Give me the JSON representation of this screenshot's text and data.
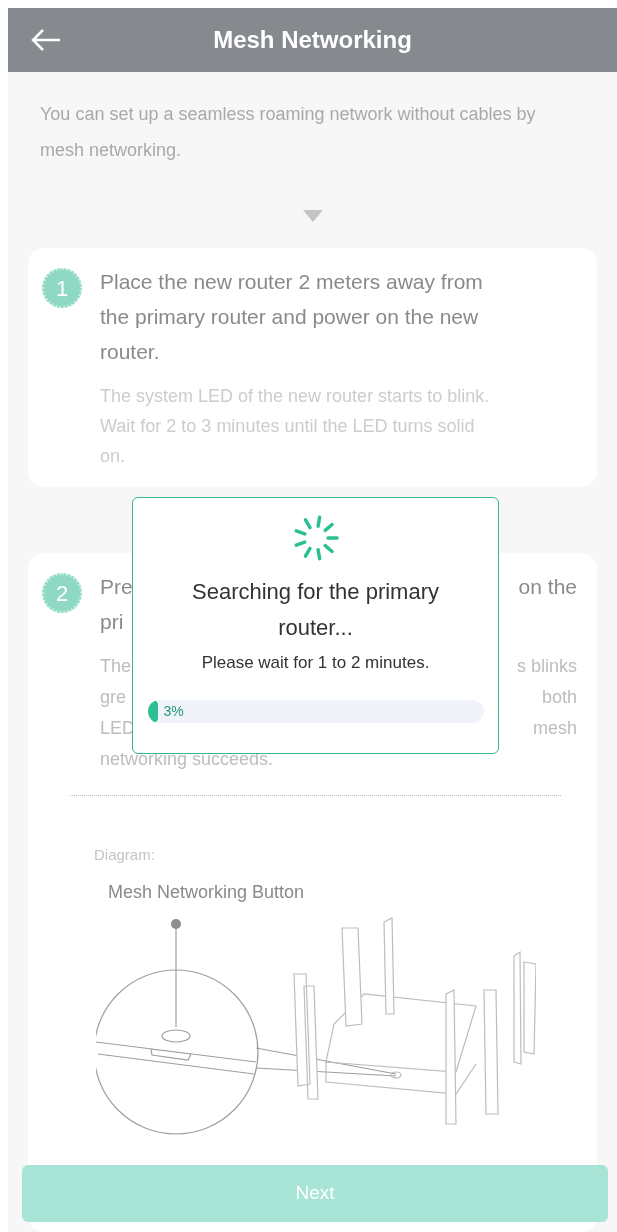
{
  "header": {
    "title": "Mesh Networking"
  },
  "intro": "You can set up a seamless roaming network without cables by mesh networking.",
  "steps": [
    {
      "number": "1",
      "title_lines": [
        {
          "left": "Place the new router 2 meters away from"
        },
        {
          "left": "the primary router and power on the new"
        },
        {
          "left": "router."
        }
      ],
      "desc_lines": [
        {
          "left": "The system LED of the new router starts to blink."
        },
        {
          "left": "Wait for 2 to 3 minutes until the LED turns solid"
        },
        {
          "left": "on."
        }
      ]
    },
    {
      "number": "2",
      "title_lines": [
        {
          "left": "Pre",
          "right": "on the"
        },
        {
          "left": "pri"
        }
      ],
      "desc_lines": [
        {
          "left": "The",
          "right": "s blinks"
        },
        {
          "left": "gre",
          "right": "both"
        },
        {
          "left": "LED",
          "right": "mesh"
        },
        {
          "left": "networking succeeds."
        }
      ],
      "diagram": {
        "label": "Diagram:",
        "callout": "Mesh Networking Button"
      }
    }
  ],
  "dialog": {
    "title": "Searching for the primary router...",
    "subtitle": "Please wait for 1 to 2 minutes.",
    "progress": {
      "level": 0.03,
      "reading": "3%"
    }
  },
  "next_button": {
    "label": "Next",
    "disabled": true
  }
}
